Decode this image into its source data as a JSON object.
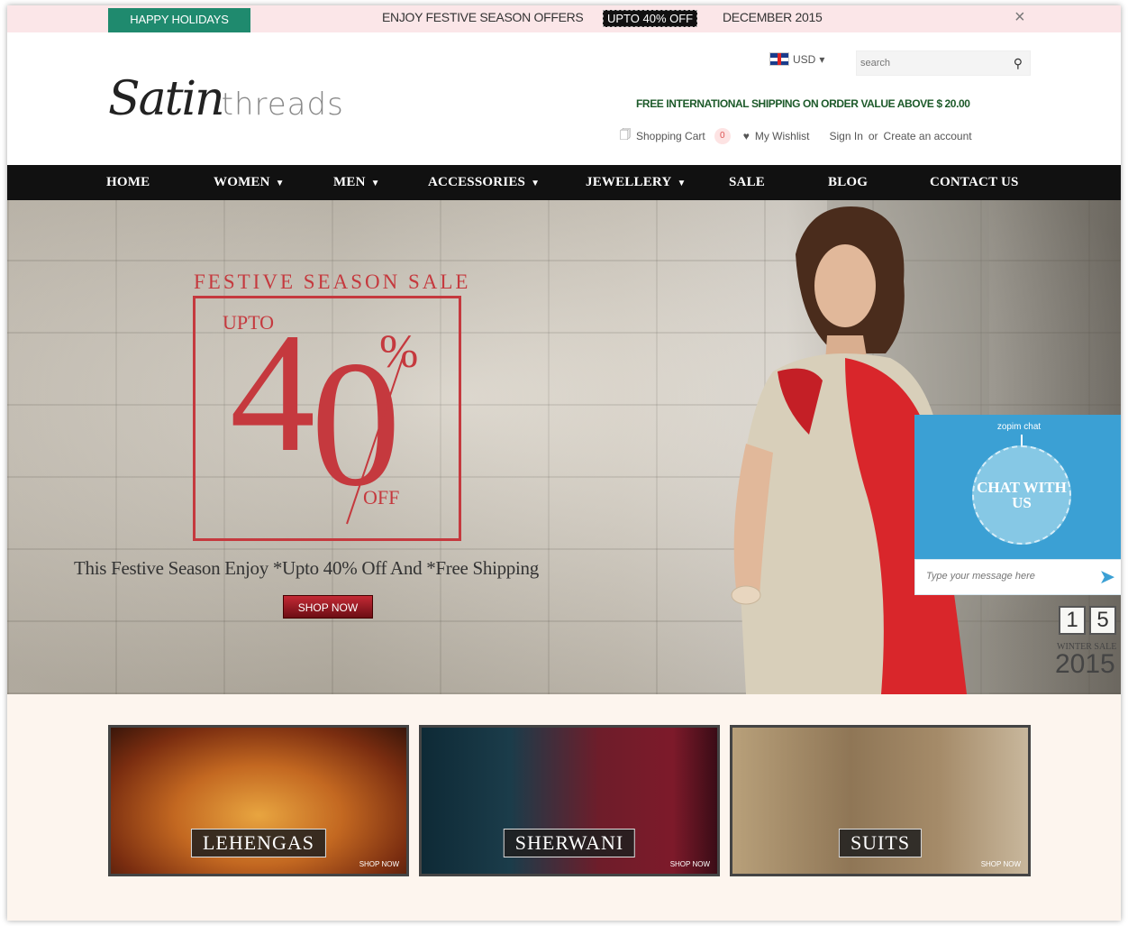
{
  "promo": {
    "holiday": "HAPPY HOLIDAYS",
    "offers": "ENJOY FESTIVE SEASON OFFERS",
    "upto": "UPTO 40% OFF",
    "date": "DECEMBER 2015",
    "close": "×"
  },
  "header": {
    "logo_script": "Satin",
    "logo_thin": "threads",
    "currency": "USD",
    "search_placeholder": "search",
    "free_shipping": "FREE INTERNATIONAL SHIPPING ON ORDER VALUE ABOVE $ 20.00",
    "cart_label": "Shopping Cart",
    "cart_count": "0",
    "wishlist": "My Wishlist",
    "sign_in": "Sign In",
    "or": "or",
    "create_account": "Create an account"
  },
  "nav": {
    "items": [
      "HOME",
      "WOMEN",
      "MEN",
      "ACCESSORIES",
      "JEWELLERY",
      "SALE",
      "BLOG",
      "CONTACT US"
    ]
  },
  "hero": {
    "festive": "FESTIVE SEASON SALE",
    "upto": "UPTO",
    "digit1": "4",
    "digit2": "0",
    "percent": "%",
    "off": "OFF",
    "tagline": "This Festive Season Enjoy *Upto 40% Off And *Free Shipping",
    "shop_now": "SHOP NOW"
  },
  "calendar": {
    "d1": "1",
    "d2": "5",
    "label": "WINTER SALE",
    "year": "2015"
  },
  "chat": {
    "brand": "zopim chat",
    "tag": "CHAT WITH US",
    "placeholder": "Type your message here"
  },
  "categories": [
    {
      "label": "LEHENGAS",
      "shop": "SHOP NOW"
    },
    {
      "label": "SHERWANI",
      "shop": "SHOP NOW"
    },
    {
      "label": "SUITS",
      "shop": "SHOP NOW"
    }
  ],
  "colors": {
    "accent_red": "#c5393e",
    "holiday_green": "#1f8a6e",
    "nav_black": "#111111",
    "chat_blue": "#3ba0d4"
  }
}
